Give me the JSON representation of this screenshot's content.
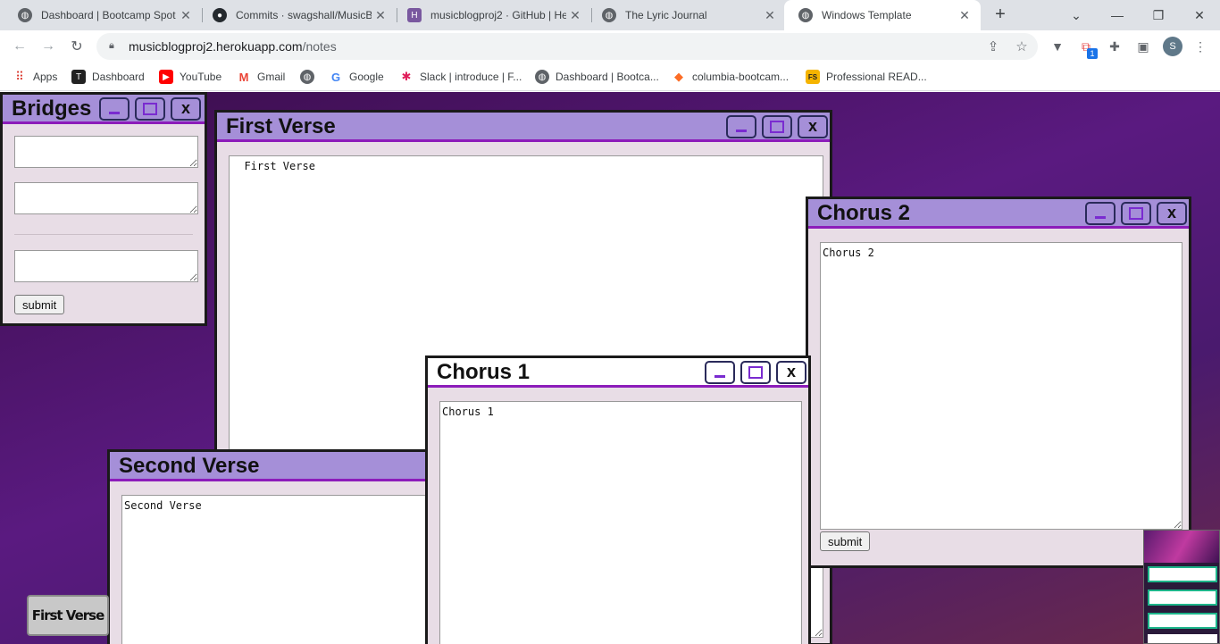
{
  "browser": {
    "tabs": [
      {
        "title": "Dashboard | Bootcamp Spot",
        "icon": "globe-icon"
      },
      {
        "title": "Commits · swagshall/MusicBl",
        "icon": "github-icon"
      },
      {
        "title": "musicblogproj2 · GitHub | He",
        "icon": "heroku-icon"
      },
      {
        "title": "The Lyric Journal",
        "icon": "globe-icon"
      },
      {
        "title": "Windows Template",
        "icon": "globe-icon",
        "active": true
      }
    ],
    "new_tab_glyph": "+",
    "url_host": "musicblogproj2.herokuapp.com",
    "url_path": "/notes",
    "profile_initial": "S",
    "extension_badge": "1",
    "bookmarks": [
      {
        "label": "Apps",
        "icon": "apps-grid-icon"
      },
      {
        "label": "Dashboard",
        "icon": "bootcamp-icon"
      },
      {
        "label": "YouTube",
        "icon": "youtube-icon"
      },
      {
        "label": "Gmail",
        "icon": "gmail-icon"
      },
      {
        "label": "",
        "icon": "globe-icon"
      },
      {
        "label": "Google",
        "icon": "google-icon"
      },
      {
        "label": "Slack | introduce | F...",
        "icon": "slack-icon"
      },
      {
        "label": "Dashboard | Bootca...",
        "icon": "globe-icon"
      },
      {
        "label": "columbia-bootcam...",
        "icon": "gitlab-icon"
      },
      {
        "label": "Professional READ...",
        "icon": "readme-icon"
      }
    ]
  },
  "windows": {
    "bridges": {
      "title": "Bridges",
      "submit": "submit"
    },
    "first_verse": {
      "title": "First Verse",
      "text": "  First Verse"
    },
    "chorus2": {
      "title": "Chorus 2",
      "text": "Chorus 2",
      "submit": "submit"
    },
    "chorus1": {
      "title": "Chorus 1",
      "text": "Chorus 1"
    },
    "second_verse": {
      "title": "Second Verse",
      "text": "Second Verse"
    },
    "min_glyph": "_",
    "close_glyph": "x"
  },
  "taskbar": {
    "button_label": "First Verse"
  },
  "colors": {
    "titlebar": "#a58fd8",
    "titlebar_border": "#8c1cba",
    "window_body": "#e8dde6",
    "page_bg": "#4a1a6e"
  }
}
